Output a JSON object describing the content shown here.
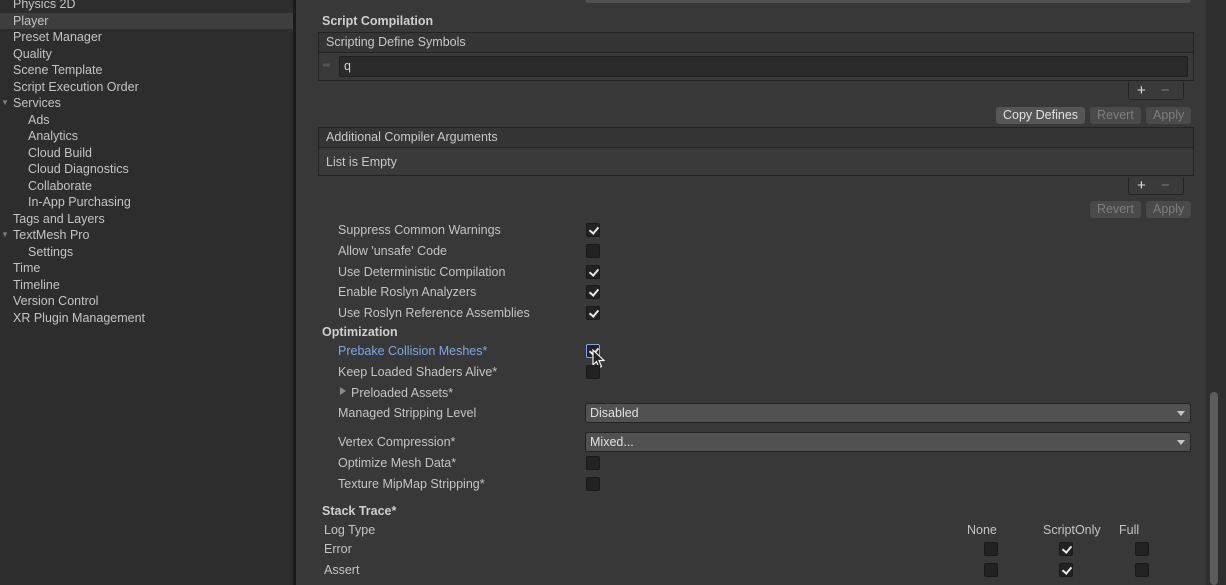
{
  "sidebar": {
    "items": [
      {
        "label": "Physics 2D",
        "indent": 0
      },
      {
        "label": "Player",
        "indent": 0,
        "selected": true
      },
      {
        "label": "Preset Manager",
        "indent": 0
      },
      {
        "label": "Quality",
        "indent": 0
      },
      {
        "label": "Scene Template",
        "indent": 0
      },
      {
        "label": "Script Execution Order",
        "indent": 0
      },
      {
        "label": "Services",
        "indent": 0,
        "expanded": true
      },
      {
        "label": "Ads",
        "indent": 1
      },
      {
        "label": "Analytics",
        "indent": 1
      },
      {
        "label": "Cloud Build",
        "indent": 1
      },
      {
        "label": "Cloud Diagnostics",
        "indent": 1
      },
      {
        "label": "Collaborate",
        "indent": 1
      },
      {
        "label": "In-App Purchasing",
        "indent": 1
      },
      {
        "label": "Tags and Layers",
        "indent": 0
      },
      {
        "label": "TextMesh Pro",
        "indent": 0,
        "expanded": true
      },
      {
        "label": "Settings",
        "indent": 1
      },
      {
        "label": "Time",
        "indent": 0
      },
      {
        "label": "Timeline",
        "indent": 0
      },
      {
        "label": "Version Control",
        "indent": 0
      },
      {
        "label": "XR Plugin Management",
        "indent": 0
      }
    ]
  },
  "script_compilation": {
    "section_title": "Script Compilation",
    "define_symbols_title": "Scripting Define Symbols",
    "define_value": "q",
    "copy_defines_label": "Copy Defines",
    "revert_label": "Revert",
    "apply_label": "Apply",
    "compiler_args_title": "Additional Compiler Arguments",
    "compiler_args_empty": "List is Empty",
    "add_symbol": "+",
    "remove_symbol": "−"
  },
  "compiler_options": [
    {
      "label": "Suppress Common Warnings",
      "checked": true
    },
    {
      "label": "Allow 'unsafe' Code",
      "checked": false
    },
    {
      "label": "Use Deterministic Compilation",
      "checked": true
    },
    {
      "label": "Enable Roslyn Analyzers",
      "checked": true
    },
    {
      "label": "Use Roslyn Reference Assemblies",
      "checked": true
    }
  ],
  "optimization": {
    "section_title": "Optimization",
    "prebake_label": "Prebake Collision Meshes*",
    "prebake_checked": true,
    "keep_shaders_label": "Keep Loaded Shaders Alive*",
    "keep_shaders_checked": false,
    "preloaded_assets_label": "Preloaded Assets*",
    "stripping_label": "Managed Stripping Level",
    "stripping_value": "Disabled",
    "vertex_label": "Vertex Compression*",
    "vertex_value": "Mixed...",
    "optimize_mesh_label": "Optimize Mesh Data*",
    "optimize_mesh_checked": false,
    "mipmap_label": "Texture MipMap Stripping*",
    "mipmap_checked": false
  },
  "stack_trace": {
    "section_title": "Stack Trace*",
    "log_type_label": "Log Type",
    "columns": [
      "None",
      "ScriptOnly",
      "Full"
    ],
    "rows": [
      {
        "label": "Error",
        "selected_col": 1
      },
      {
        "label": "Assert",
        "selected_col": 1
      }
    ]
  },
  "colors": {
    "sidebar_bg": "#2d2d2d",
    "main_bg": "#383838",
    "highlight_text": "#7fa7e8"
  }
}
